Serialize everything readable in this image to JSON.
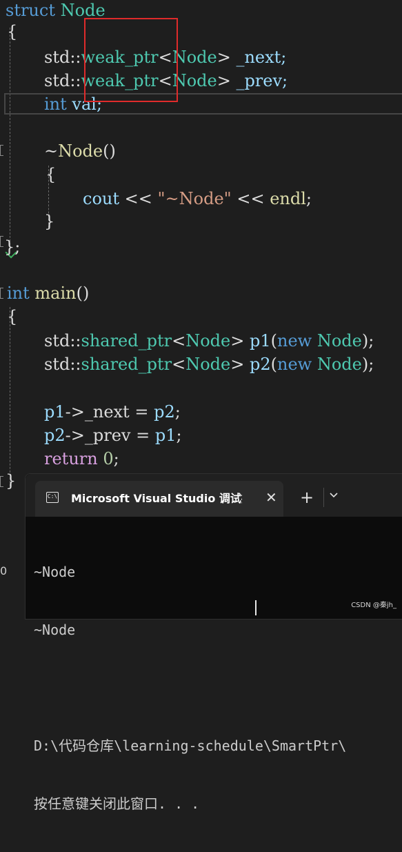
{
  "editor": {
    "line1": {
      "kw": "struct",
      "name": "Node"
    },
    "line2": {
      "brace": "{"
    },
    "line3": {
      "ns": "std::",
      "type": "weak_ptr",
      "lt": "<",
      "targ": "Node",
      "gt": ">",
      "member": " _next;"
    },
    "line4": {
      "ns": "std::",
      "type": "weak_ptr",
      "lt": "<",
      "targ": "Node",
      "gt": ">",
      "member": " _prev;"
    },
    "line5": {
      "kw": "int",
      "rest": " val;"
    },
    "line6": {
      "tilde": "~",
      "fn": "Node",
      "parens": "()"
    },
    "line7": {
      "brace": "{"
    },
    "line8": {
      "cout": "cout",
      "op1": " << ",
      "q1": "\"",
      "str": "~Node",
      "q2": "\"",
      "op2": " << ",
      "endl": "endl",
      "semi": ";"
    },
    "line9": {
      "brace": "}"
    },
    "line10": {
      "brace": "};"
    },
    "line11": {
      "kw": "int",
      "fn": "main",
      "parens": "()"
    },
    "line12": {
      "brace": "{"
    },
    "line13": {
      "ns": "std::",
      "type": "shared_ptr",
      "lt": "<",
      "targ": "Node",
      "gt": ">",
      "var": "p1",
      "p1": "(",
      "new": "new",
      "node": "Node",
      "end": ");"
    },
    "line14": {
      "ns": "std::",
      "type": "shared_ptr",
      "lt": "<",
      "targ": "Node",
      "gt": ">",
      "var": "p2",
      "p1": "(",
      "new": "new",
      "node": "Node",
      "end": ");"
    },
    "line15": {
      "var": "p1",
      "arrow": "->",
      "member": "_next",
      "eq": " = ",
      "rhs": "p2",
      "semi": ";"
    },
    "line16": {
      "var": "p2",
      "arrow": "->",
      "member": "_prev",
      "eq": " = ",
      "rhs": "p1",
      "semi": ";"
    },
    "line17": {
      "kw": "return",
      "sp": " ",
      "num": "0",
      "semi": ";"
    },
    "line18": {
      "brace": "}"
    },
    "gutter_number": "0"
  },
  "console": {
    "tab_title": "Microsoft Visual Studio 调试控制台",
    "icon_text": "C:\\",
    "close_glyph": "✕",
    "add_glyph": "+",
    "output_lines": [
      "~Node",
      "~Node",
      "",
      "D:\\代码仓库\\learning-schedule\\SmartPtr\\",
      "按任意键关闭此窗口. . ."
    ]
  },
  "watermark": "CSDN @秦jh_",
  "colors": {
    "background": "#1e1e1e",
    "keyword": "#569cd6",
    "type": "#4ec9b0",
    "function": "#dcdcaa",
    "variable": "#9cdcfe",
    "string": "#d69d85",
    "control": "#d8a0df",
    "highlight_border": "#e02b2b"
  }
}
